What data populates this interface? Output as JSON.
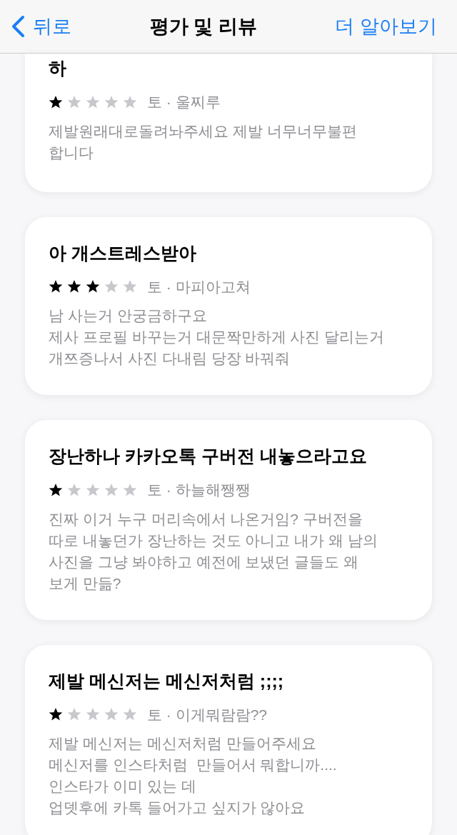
{
  "nav": {
    "back": "뒤로",
    "title": "평가 및 리뷰",
    "more": "더 알아보기"
  },
  "reviews": [
    {
      "title": "하",
      "stars": 1,
      "meta": "토 · 울찌루",
      "body": "제발원래대로돌려놔주세요 제발 너무너무불편\n합니다"
    },
    {
      "title": "아 개스트레스받아",
      "stars": 3,
      "meta": "토 · 마피아고쳐",
      "body": "남 사는거 안궁금하구요\n제사 프로필 바꾸는거 대문짝만하게 사진 달리는거\n개쯔증나서 사진 다내림 당장 바꿔줘"
    },
    {
      "title": "장난하나 카카오톡 구버전 내놓으라고요",
      "stars": 1,
      "meta": "토 · 하늘해쨍쨍",
      "body": "진짜 이거 누구 머리속에서 나온거임? 구버전을\n따로 내놓던가 장난하는 것도 아니고 내가 왜 남의\n사진을 그냥 봐야하고 예전에 보냈던 글들도 왜\n보게 만듦?"
    },
    {
      "title": "제발 메신저는 메신저처럼 ;;;;",
      "stars": 1,
      "meta": "토 · 이게뭐람람??",
      "body": "제발 메신저는 메신저처럼 만들어주세요\n메신저를 인스타처럼  만들어서 뭐합니까....\n인스타가 이미 있는 데\n업뎃후에 카톡 들어가고 싶지가 않아요"
    }
  ]
}
